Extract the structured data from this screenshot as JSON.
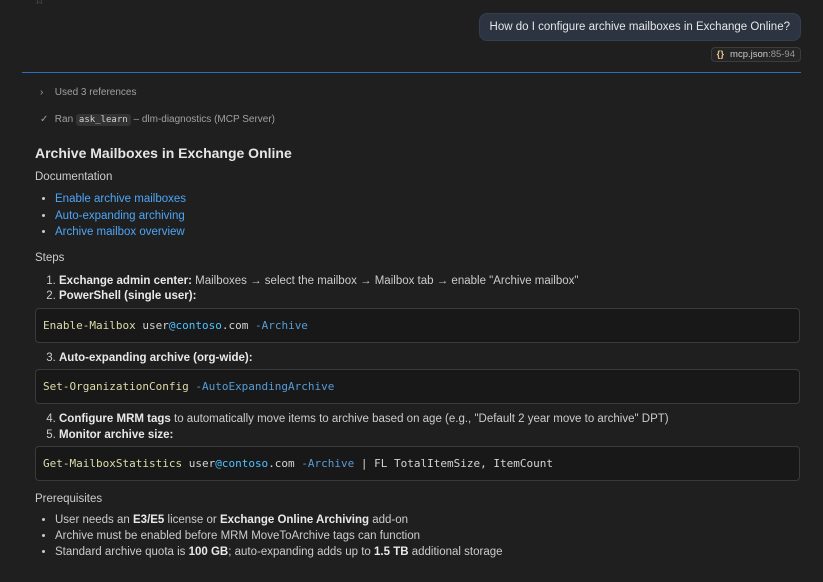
{
  "user_message": "How do I configure archive mailboxes in Exchange Online?",
  "reference_chip": {
    "icon": "{}",
    "file": "mcp.json",
    "lines": ":85-94"
  },
  "references": "Used 3 references",
  "tool_run": {
    "prefix": "Ran",
    "tool": "ask_learn",
    "suffix": "– dlm-diagnostics (MCP Server)"
  },
  "response": {
    "title": "Archive Mailboxes in Exchange Online",
    "documentation_label": "Documentation",
    "doc_links": [
      "Enable archive mailboxes",
      "Auto-expanding archiving",
      "Archive mailbox overview"
    ],
    "steps_label": "Steps",
    "steps": [
      {
        "bold": "Exchange admin center:",
        "text": " Mailboxes → select the mailbox → Mailbox tab → enable \"Archive mailbox\""
      },
      {
        "bold": "PowerShell (single user):",
        "text": ""
      },
      {
        "bold": "Auto-expanding archive (org-wide):",
        "text": ""
      },
      {
        "bold": "Configure MRM tags",
        "text": " to automatically move items to archive based on age (e.g., \"Default 2 year move to archive\" DPT)"
      },
      {
        "bold": "Monitor archive size:",
        "text": ""
      }
    ],
    "code_blocks": [
      [
        {
          "cls": "cmd",
          "t": "Enable-Mailbox"
        },
        {
          "cls": "plain",
          "t": " user"
        },
        {
          "cls": "at",
          "t": "@contoso"
        },
        {
          "cls": "plain",
          "t": ".com "
        },
        {
          "cls": "param",
          "t": "-Archive"
        }
      ],
      [
        {
          "cls": "cmd",
          "t": "Set-OrganizationConfig"
        },
        {
          "cls": "plain",
          "t": " "
        },
        {
          "cls": "param",
          "t": "-AutoExpandingArchive"
        }
      ],
      [
        {
          "cls": "cmd",
          "t": "Get-MailboxStatistics"
        },
        {
          "cls": "plain",
          "t": " user"
        },
        {
          "cls": "at",
          "t": "@contoso"
        },
        {
          "cls": "plain",
          "t": ".com "
        },
        {
          "cls": "param",
          "t": "-Archive"
        },
        {
          "cls": "plain",
          "t": " | FL TotalItemSize, ItemCount"
        }
      ]
    ],
    "prerequisites_label": "Prerequisites",
    "prerequisites": [
      [
        {
          "t": "User needs an "
        },
        {
          "b": true,
          "t": "E3/E5"
        },
        {
          "t": " license or "
        },
        {
          "b": true,
          "t": "Exchange Online Archiving"
        },
        {
          "t": " add-on"
        }
      ],
      [
        {
          "t": "Archive must be enabled before MRM MoveToArchive tags can function"
        }
      ],
      [
        {
          "t": "Standard archive quota is "
        },
        {
          "b": true,
          "t": "100 GB"
        },
        {
          "t": "; auto-expanding adds up to "
        },
        {
          "b": true,
          "t": "1.5 TB"
        },
        {
          "t": " additional storage"
        }
      ]
    ]
  }
}
